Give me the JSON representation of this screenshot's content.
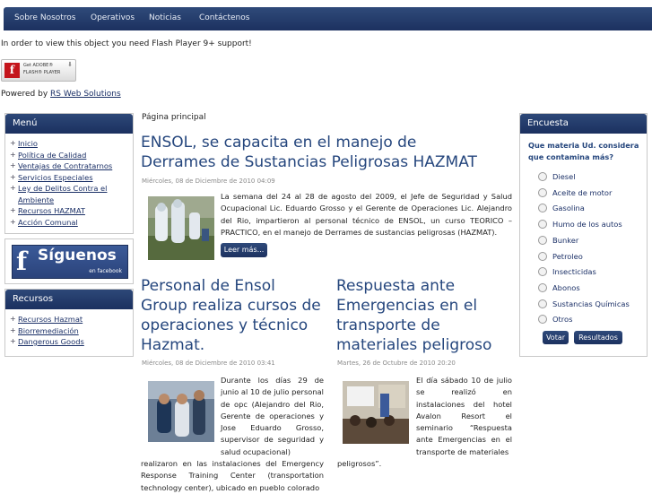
{
  "nav": {
    "items": [
      "Sobre Nosotros",
      "Operativos",
      "Noticias",
      "Contáctenos"
    ]
  },
  "flash": {
    "message": "In order to view this object you need Flash Player 9+ support!",
    "button_line1": "Get ADOBE®",
    "button_line2": "FLASH® PLAYER",
    "button_logo": "f"
  },
  "powered": {
    "prefix": "Powered by ",
    "link": "RS Web Solutions"
  },
  "menu": {
    "title": "Menú",
    "items": [
      "Inicio",
      "Política de Calidad",
      "Ventajas de Contratarnos",
      "Servicios Especiales",
      "Ley de Delitos Contra el Ambiente",
      "Recursos HAZMAT",
      "Acción Comunal"
    ]
  },
  "facebook": {
    "f": "f",
    "siguenos": "Síguenos",
    "en": "en facebook"
  },
  "recursos": {
    "title": "Recursos",
    "items": [
      "Recursos Hazmat",
      "Biorremediación",
      "Dangerous Goods"
    ]
  },
  "breadcrumb": "Página principal",
  "article1": {
    "title": "ENSOL, se capacita en el manejo de Derrames de Sustancias Peligrosas HAZMAT",
    "date": "Miércoles, 08 de Diciembre de 2010 04:09",
    "text": "La semana del 24 al 28 de agosto del 2009, el Jefe de Seguridad y Salud Ocupacional Lic. Eduardo Grosso y el Gerente de Operaciones  Lic. Alejandro del Rio, impartieron al personal técnico de ENSOL, un curso TEORICO – PRACTICO, en el manejo de Derrames de sustancias peligrosas (HAZMAT).",
    "read_more": "Leer más..."
  },
  "article2": {
    "title": "Personal de Ensol Group realiza cursos de operaciones y técnico Hazmat.",
    "date": "Miércoles, 08 de Diciembre de 2010 03:41",
    "text_side": "Durante los días 29 de junio al 10 de julio personal de opc (Alejandro del Rio, Gerente de operaciones y Jose Eduardo Grosso, supervisor de seguridad y salud ocupacional)",
    "text_full": "realizaron en las instalaciones del Emergency Response Training Center (transportation technology center), ubicado en pueblo colorado"
  },
  "article3": {
    "title": "Respuesta ante Emergencias en el transporte de materiales peligroso",
    "date": "Martes, 26 de Octubre de 2010 20:20",
    "text_side": "El día sábado 10 de julio se realizó en instalaciones del hotel Avalon Resort el seminario “Respuesta ante Emergencias en el transporte de materiales",
    "text_full": "peligrosos”."
  },
  "poll": {
    "title": "Encuesta",
    "question": "Que materia Ud. considera que contamina más?",
    "options": [
      "Diesel",
      "Aceite de motor",
      "Gasolina",
      "Humo de los autos",
      "Bunker",
      "Petroleo",
      "Insecticidas",
      "Abonos",
      "Sustancias Químicas",
      "Otros"
    ],
    "vote": "Votar",
    "results": "Resultados"
  }
}
